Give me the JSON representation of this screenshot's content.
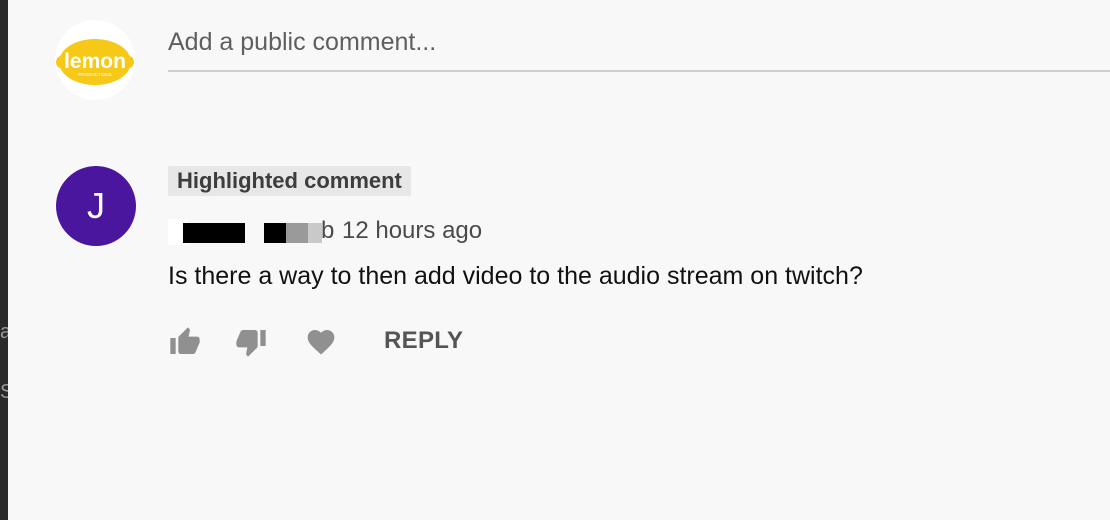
{
  "left_strip": {
    "fragment_1": "a",
    "fragment_2": "Se"
  },
  "own_avatar": {
    "logo_text": "lemon",
    "logo_subtext": "PRODUCTIONS",
    "color": "#f6c817"
  },
  "comment_input": {
    "placeholder": "Add a public comment..."
  },
  "comment": {
    "avatar_letter": "J",
    "avatar_color": "#4a169e",
    "badge": "Highlighted comment",
    "author_tail": "b",
    "timestamp": "12 hours ago",
    "text": "Is there a way to then add video to the audio stream on twitch?"
  },
  "actions": {
    "like_icon": "thumbs-up-icon",
    "dislike_icon": "thumbs-down-icon",
    "heart_icon": "heart-icon",
    "reply_label": "REPLY"
  }
}
